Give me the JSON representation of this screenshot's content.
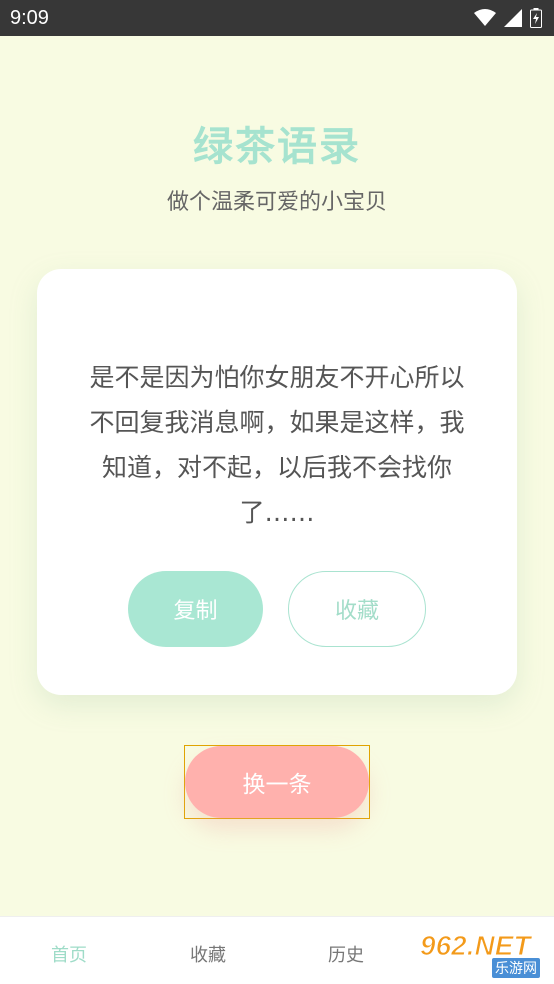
{
  "status_bar": {
    "time": "9:09",
    "icons": [
      "wifi-icon",
      "signal-icon",
      "battery-icon"
    ]
  },
  "header": {
    "title": "绿茶语录",
    "subtitle": "做个温柔可爱的小宝贝"
  },
  "card": {
    "quote": "是不是因为怕你女朋友不开心所以不回复我消息啊，如果是这样，我知道，对不起，以后我不会找你了……",
    "copy_label": "复制",
    "favorite_label": "收藏"
  },
  "next_label": "换一条",
  "tabs": [
    {
      "label": "首页",
      "active": true
    },
    {
      "label": "收藏",
      "active": false
    },
    {
      "label": "历史",
      "active": false
    }
  ],
  "watermark": {
    "main": "962.NET",
    "sub": "乐游网"
  },
  "colors": {
    "background": "#f8fbe2",
    "accent_green": "#a9e7d3",
    "accent_pink": "#ffb1ad",
    "status_bar": "#373737"
  }
}
